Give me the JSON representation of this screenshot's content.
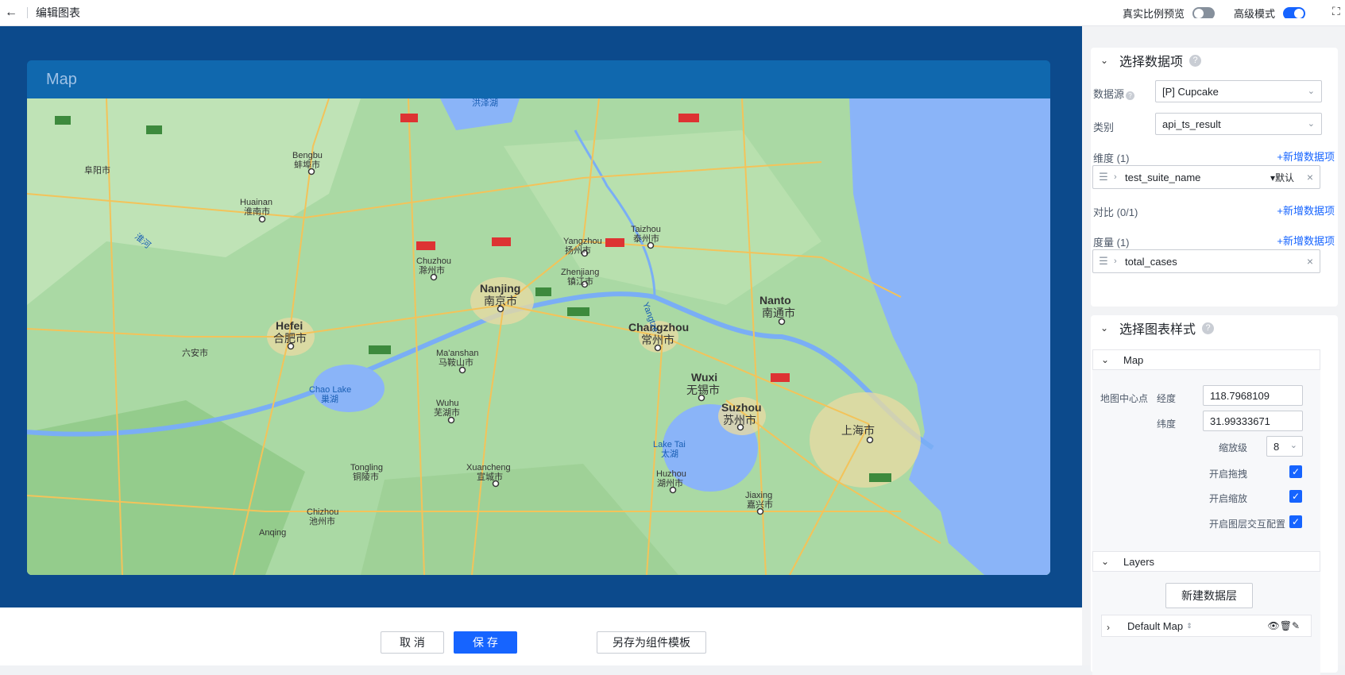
{
  "topbar": {
    "back_icon": "arrow-left-icon",
    "title": "编辑图表",
    "real_ratio_label": "真实比例预览",
    "real_ratio_on": false,
    "advanced_label": "高级模式",
    "advanced_on": true
  },
  "chart": {
    "title": "Map"
  },
  "map_labels": {
    "nanjing_en": "Nanjing",
    "nanjing_cn": "南京市",
    "hefei_en": "Hefei",
    "hefei_cn": "合肥市",
    "changzhou_en": "Changzhou",
    "changzhou_cn": "常州市",
    "wuxi_en": "Wuxi",
    "wuxi_cn": "无锡市",
    "suzhou_en": "Suzhou",
    "suzhou_cn": "苏州市",
    "shanghai_cn": "上海市",
    "nantong_en": "Nanto",
    "nantong_cn": "南通市",
    "yangzhou_en": "Yangzhou",
    "yangzhou_cn": "扬州市",
    "zhenjiang_en": "Zhenjiang",
    "zhenjiang_cn": "镇江市",
    "taizhou_en": "Taizhou",
    "taizhou_cn": "泰州市",
    "bengbu_en": "Bengbu",
    "bengbu_cn": "蚌埠市",
    "huainan_en": "Huainan",
    "huainan_cn": "淮南市",
    "fuyang_cn": "阜阳市",
    "chuzhou_en": "Chuzhou",
    "chuzhou_cn": "滁州市",
    "maanshan_en": "Ma'anshan",
    "maanshan_cn": "马鞍山市",
    "wuhu_en": "Wuhu",
    "wuhu_cn": "芜湖市",
    "luan_cn": "六安市",
    "chaolake_en": "Chao Lake",
    "chaolake_cn": "巢湖",
    "laketai_en": "Lake Tai",
    "laketai_cn": "太湖",
    "huzhou_en": "Huzhou",
    "huzhou_cn": "湖州市",
    "jiaxing_en": "Jiaxing",
    "jiaxing_cn": "嘉兴市",
    "xuancheng_en": "Xuancheng",
    "xuancheng_cn": "宣城市",
    "tongling_en": "Tongling",
    "tongling_cn": "铜陵市",
    "chizhou_en": "Chizhou",
    "chizhou_cn": "池州市",
    "anqing_en": "Anqing",
    "hongze_cn": "洪泽湖",
    "yangtze_en": "Yangtze",
    "huaihe_cn": "淮河"
  },
  "footer": {
    "cancel_label": "取 消",
    "save_label": "保 存",
    "save_template_label": "另存为组件模板"
  },
  "data_section": {
    "title": "选择数据项",
    "help_icon": "question-icon",
    "datasource_label": "数据源",
    "datasource_value": "[P] Cupcake",
    "category_label": "类别",
    "category_value": "api_ts_result",
    "dimension_label": "维度 (1)",
    "add_label": "+新增数据项",
    "dimension_field": "test_suite_name",
    "dimension_default": "默认",
    "compare_label": "对比 (0/1)",
    "measure_label": "度量 (1)",
    "measure_field": "total_cases"
  },
  "style_section": {
    "title": "选择图表样式",
    "map_heading": "Map",
    "center_label": "地图中心点",
    "lng_label": "经度",
    "lng_value": "118.7968109",
    "lat_label": "纬度",
    "lat_value": "31.99333671",
    "zoom_label": "缩放级",
    "zoom_value": "8",
    "drag_label": "开启拖拽",
    "drag_on": true,
    "zoomable_label": "开启缩放",
    "zoomable_on": true,
    "layer_interact_label": "开启图层交互配置",
    "layer_interact_on": true,
    "layers_heading": "Layers",
    "new_layer_label": "新建数据层",
    "default_layer_label": "Default Map"
  }
}
